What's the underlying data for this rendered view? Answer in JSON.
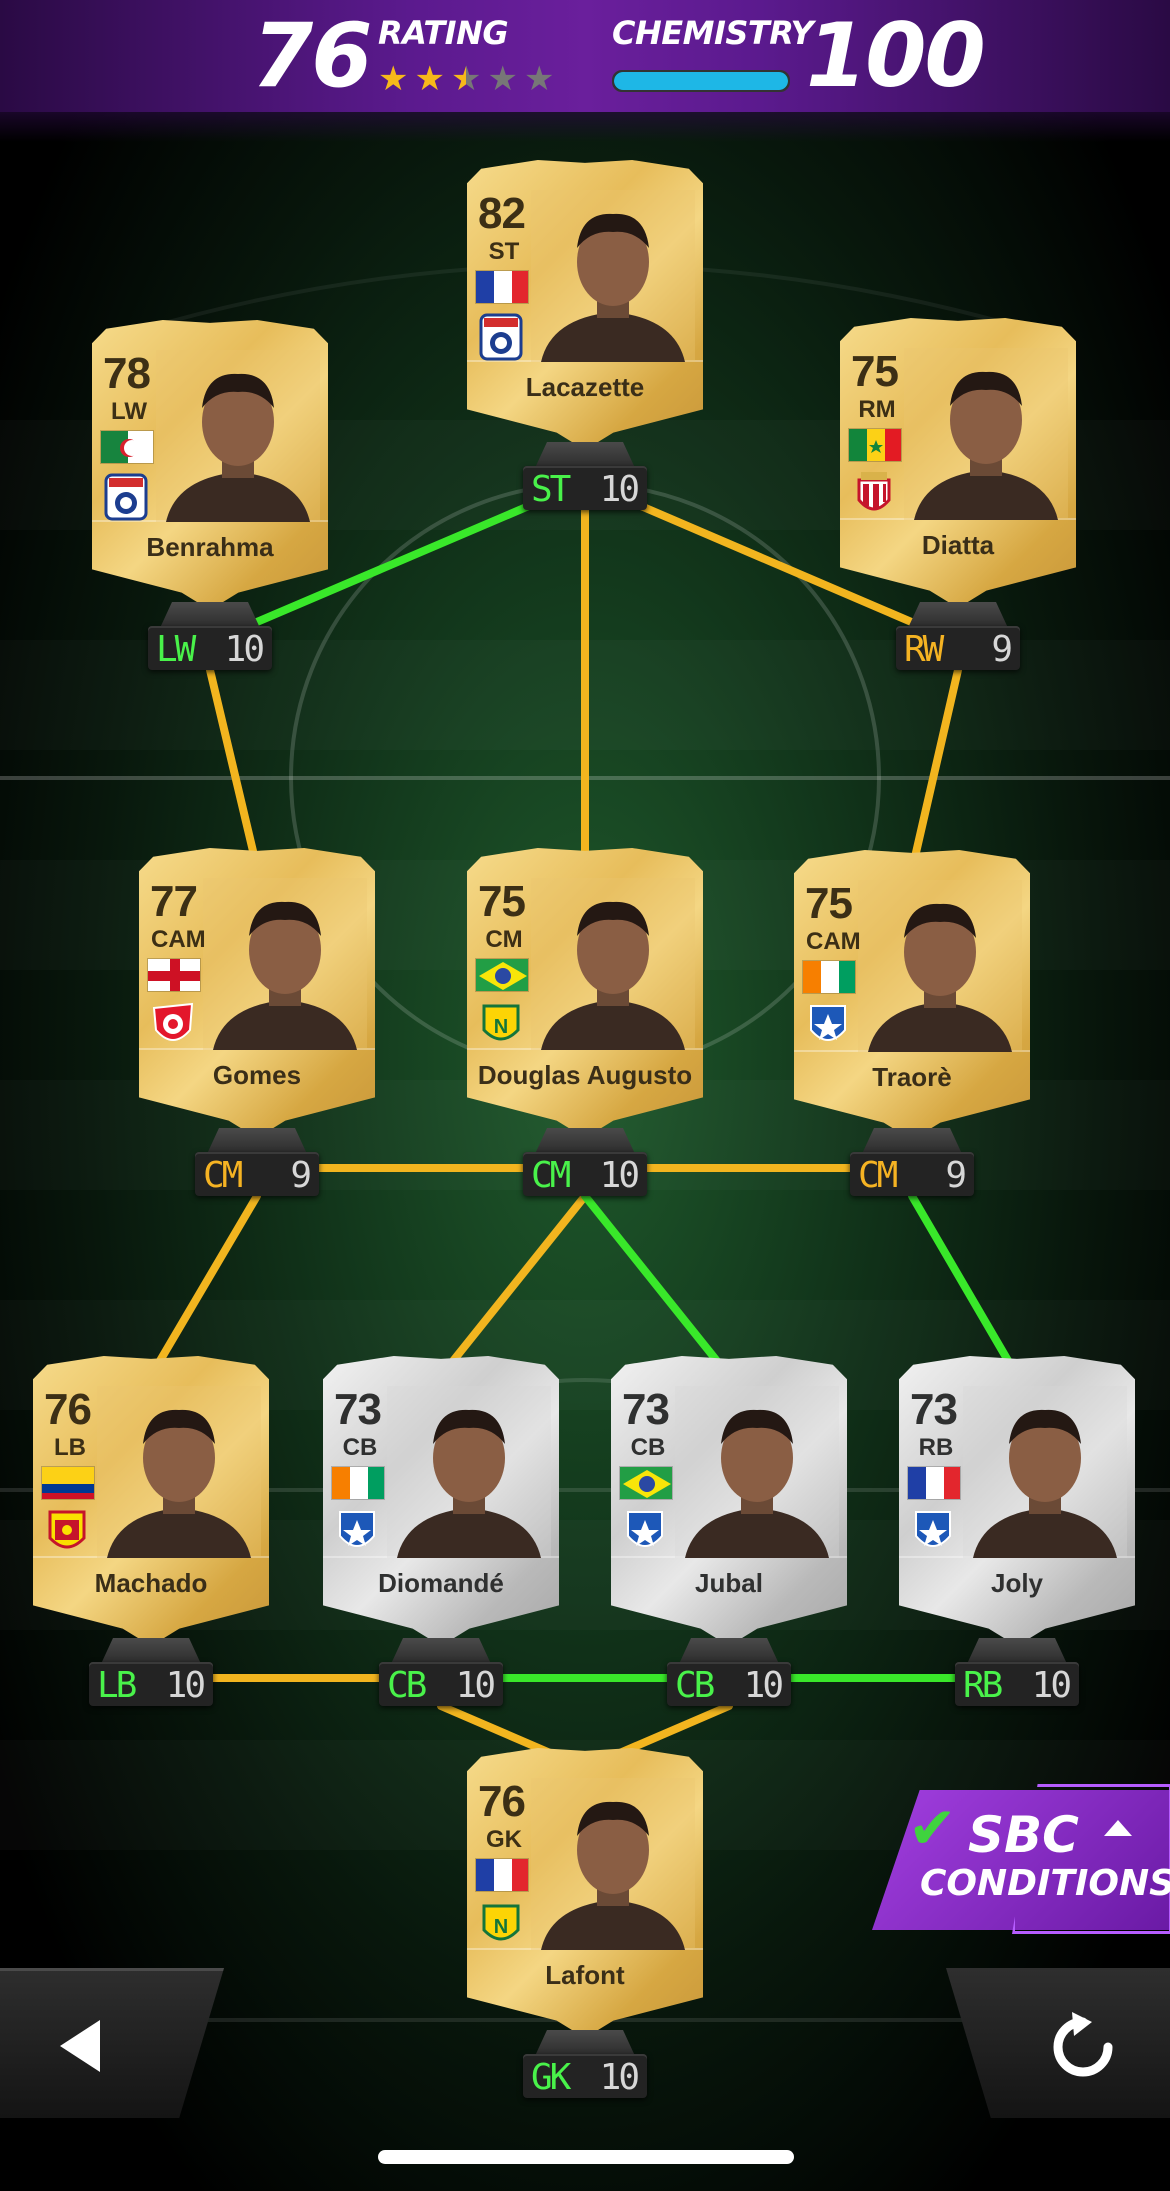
{
  "header": {
    "rating_value": "76",
    "rating_label": "RATING",
    "chemistry_label": "CHEMISTRY",
    "chemistry_value": "100",
    "stars": 2.5,
    "stars_total": 5,
    "chemistry_bar_fraction": 1.0,
    "chemistry_bar_color": "#1eb7e6"
  },
  "players": [
    {
      "id": "lacazette",
      "name": "Lacazette",
      "rating": "82",
      "card_pos": "ST",
      "flag": "france-flag",
      "club": "lyon-crest",
      "tier": "gold",
      "slot_pos": "ST",
      "slot_chem": "10",
      "slot_color": "green"
    },
    {
      "id": "benrahma",
      "name": "Benrahma",
      "rating": "78",
      "card_pos": "LW",
      "flag": "algeria-flag",
      "club": "lyon-crest",
      "tier": "gold",
      "slot_pos": "LW",
      "slot_chem": "10",
      "slot_color": "green"
    },
    {
      "id": "diatta",
      "name": "Diatta",
      "rating": "75",
      "card_pos": "RM",
      "flag": "senegal-flag",
      "club": "monaco-crest",
      "tier": "gold",
      "slot_pos": "RW",
      "slot_chem": "9",
      "slot_color": "yellow"
    },
    {
      "id": "gomes",
      "name": "Gomes",
      "rating": "77",
      "card_pos": "CAM",
      "flag": "england-flag",
      "club": "lille-crest",
      "tier": "gold",
      "slot_pos": "CM",
      "slot_chem": "9",
      "slot_color": "yellow"
    },
    {
      "id": "augusto",
      "name": "Douglas Augusto",
      "rating": "75",
      "card_pos": "CM",
      "flag": "brazil-flag",
      "club": "nantes-crest",
      "tier": "gold",
      "slot_pos": "CM",
      "slot_chem": "10",
      "slot_color": "green"
    },
    {
      "id": "traore",
      "name": "Traorè",
      "rating": "75",
      "card_pos": "CAM",
      "flag": "ivory-coast-flag",
      "club": "auxerre-crest",
      "tier": "gold",
      "slot_pos": "CM",
      "slot_chem": "9",
      "slot_color": "yellow"
    },
    {
      "id": "machado",
      "name": "Machado",
      "rating": "76",
      "card_pos": "LB",
      "flag": "colombia-flag",
      "club": "lens-crest",
      "tier": "gold",
      "slot_pos": "LB",
      "slot_chem": "10",
      "slot_color": "green"
    },
    {
      "id": "diomande",
      "name": "Diomandé",
      "rating": "73",
      "card_pos": "CB",
      "flag": "ivory-coast-flag",
      "club": "auxerre-crest",
      "tier": "silver",
      "slot_pos": "CB",
      "slot_chem": "10",
      "slot_color": "green"
    },
    {
      "id": "jubal",
      "name": "Jubal",
      "rating": "73",
      "card_pos": "CB",
      "flag": "brazil-flag",
      "club": "auxerre-crest",
      "tier": "silver",
      "slot_pos": "CB",
      "slot_chem": "10",
      "slot_color": "green"
    },
    {
      "id": "joly",
      "name": "Joly",
      "rating": "73",
      "card_pos": "RB",
      "flag": "france-flag",
      "club": "auxerre-crest",
      "tier": "silver",
      "slot_pos": "RB",
      "slot_chem": "10",
      "slot_color": "green"
    },
    {
      "id": "lafont",
      "name": "Lafont",
      "rating": "76",
      "card_pos": "GK",
      "flag": "france-flag",
      "club": "nantes-crest",
      "tier": "gold",
      "slot_pos": "GK",
      "slot_chem": "10",
      "slot_color": "green"
    }
  ],
  "sbc": {
    "title": "SBC",
    "subtitle": "CONDITIONS",
    "check_icon": "check-icon",
    "caret_icon": "caret-up-icon"
  },
  "nav": {
    "back_icon": "back-arrow-icon",
    "reset_icon": "reset-icon"
  },
  "colors": {
    "link_green": "#39e82a",
    "link_yellow": "#f2b51f",
    "gold_card": "#e7bd5b",
    "silver_card": "#cfcfcf",
    "accent_purple": "#6a1f9c"
  }
}
